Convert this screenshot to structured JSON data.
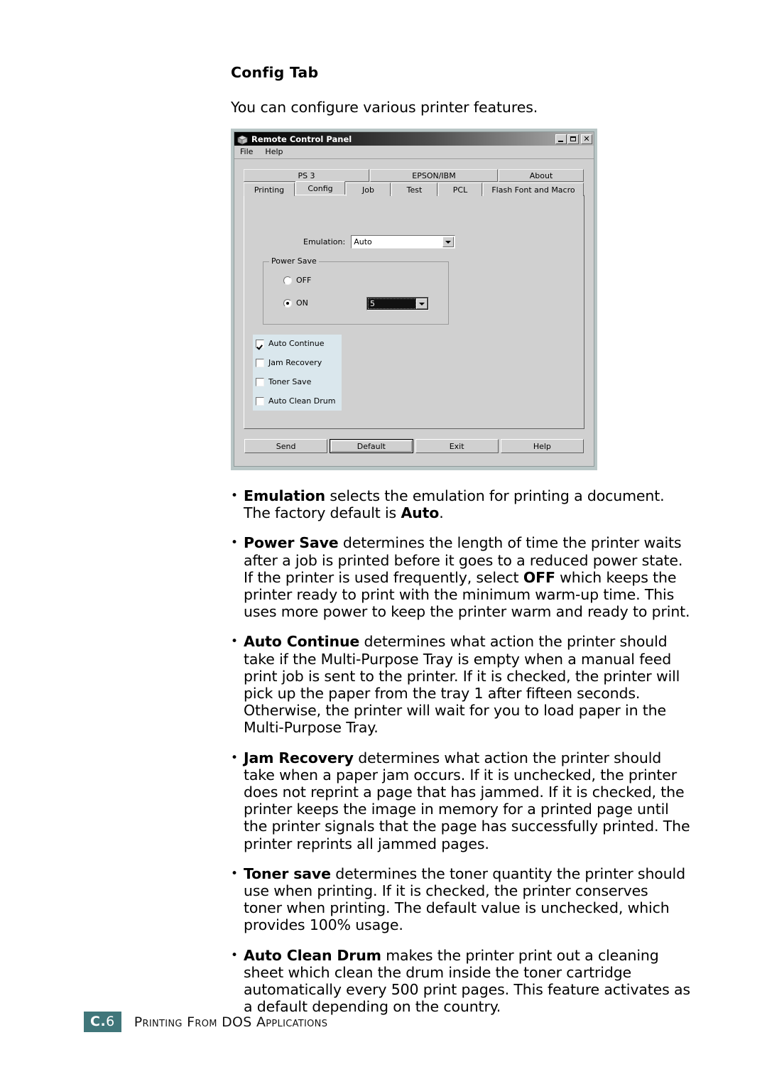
{
  "page": {
    "heading": "Config Tab",
    "intro": "You can configure various printer features.",
    "accent_color": "#40767a"
  },
  "dialog": {
    "title": "Remote Control Panel",
    "icon": "printer-box-icon",
    "window_buttons": {
      "minimize": "_",
      "maximize": "□",
      "close": "✕"
    },
    "menu": [
      {
        "label": "File"
      },
      {
        "label": "Help"
      }
    ],
    "tabs_row1": [
      {
        "label": "PS 3",
        "selected": false
      },
      {
        "label": "EPSON/IBM",
        "selected": false
      },
      {
        "label": "About",
        "selected": false
      }
    ],
    "tabs_row2": [
      {
        "label": "Printing",
        "selected": false
      },
      {
        "label": "Config",
        "selected": true
      },
      {
        "label": "Job",
        "selected": false
      },
      {
        "label": "Test",
        "selected": false
      },
      {
        "label": "PCL",
        "selected": false
      },
      {
        "label": "Flash Font and Macro",
        "selected": false
      }
    ],
    "emulation": {
      "label": "Emulation:",
      "value": "Auto"
    },
    "power_save": {
      "group_label": "Power Save",
      "options": [
        {
          "label": "OFF",
          "selected": false
        },
        {
          "label": "ON",
          "selected": true
        }
      ],
      "minutes_value": "5"
    },
    "checkboxes": [
      {
        "label": "Auto Continue",
        "checked": true
      },
      {
        "label": "Jam Recovery",
        "checked": false
      },
      {
        "label": "Toner Save",
        "checked": false
      },
      {
        "label": "Auto Clean Drum",
        "checked": false
      }
    ],
    "buttons": [
      {
        "label": "Send",
        "default": false
      },
      {
        "label": "Default",
        "default": true
      },
      {
        "label": "Exit",
        "default": false
      },
      {
        "label": "Help",
        "default": false
      }
    ]
  },
  "bullets": [
    {
      "id": "emulation",
      "lines": [
        [
          {
            "b": true,
            "t": "Emulation"
          },
          {
            "b": false,
            "t": " selects the emulation for printing a document."
          }
        ],
        [
          {
            "b": false,
            "t": "The factory default is "
          },
          {
            "b": true,
            "t": "Auto"
          },
          {
            "b": false,
            "t": "."
          }
        ]
      ]
    },
    {
      "id": "power-save",
      "lines": [
        [
          {
            "b": true,
            "t": "Power Save"
          },
          {
            "b": false,
            "t": " determines the length of time the printer waits"
          }
        ],
        [
          {
            "b": false,
            "t": "after a job is printed before it goes to a reduced power state."
          }
        ],
        [
          {
            "b": false,
            "t": "If the printer is used frequently, select "
          },
          {
            "b": true,
            "t": "OFF"
          },
          {
            "b": false,
            "t": " which keeps the"
          }
        ],
        [
          {
            "b": false,
            "t": "printer ready to print with the minimum warm-up time. This"
          }
        ],
        [
          {
            "b": false,
            "t": "uses more power to keep the printer warm and ready to print."
          }
        ]
      ]
    },
    {
      "id": "auto-continue",
      "lines": [
        [
          {
            "b": true,
            "t": "Auto Continue"
          },
          {
            "b": false,
            "t": " determines what action the printer should"
          }
        ],
        [
          {
            "b": false,
            "t": "take if the Multi-Purpose Tray is empty when a manual feed"
          }
        ],
        [
          {
            "b": false,
            "t": "print job is sent to the printer. If it is checked, the printer will"
          }
        ],
        [
          {
            "b": false,
            "t": "pick up the paper from the tray 1 after fifteen seconds."
          }
        ],
        [
          {
            "b": false,
            "t": "Otherwise, the printer will wait for you to load paper in the"
          }
        ],
        [
          {
            "b": false,
            "t": "Multi-Purpose Tray."
          }
        ]
      ]
    },
    {
      "id": "jam-recovery",
      "lines": [
        [
          {
            "b": true,
            "t": "Jam Recovery"
          },
          {
            "b": false,
            "t": " determines what action the printer should"
          }
        ],
        [
          {
            "b": false,
            "t": "take when a paper jam occurs. If it is unchecked, the printer"
          }
        ],
        [
          {
            "b": false,
            "t": "does not reprint a page that has jammed. If it is checked, the"
          }
        ],
        [
          {
            "b": false,
            "t": "printer keeps the image in memory for a printed page until"
          }
        ],
        [
          {
            "b": false,
            "t": "the printer signals that the page has successfully printed. The"
          }
        ],
        [
          {
            "b": false,
            "t": "printer reprints all jammed pages."
          }
        ]
      ]
    },
    {
      "id": "toner-save",
      "lines": [
        [
          {
            "b": true,
            "t": "Toner save"
          },
          {
            "b": false,
            "t": " determines the toner quantity the printer should"
          }
        ],
        [
          {
            "b": false,
            "t": "use when printing. If it is checked, the printer conserves"
          }
        ],
        [
          {
            "b": false,
            "t": "toner when printing. The default value is unchecked, which"
          }
        ],
        [
          {
            "b": false,
            "t": "provides 100% usage."
          }
        ]
      ]
    },
    {
      "id": "auto-clean-drum",
      "lines": [
        [
          {
            "b": true,
            "t": "Auto Clean Drum"
          },
          {
            "b": false,
            "t": " makes the printer print out a cleaning"
          }
        ],
        [
          {
            "b": false,
            "t": "sheet which clean the drum inside the toner cartridge"
          }
        ],
        [
          {
            "b": false,
            "t": "automatically every 500 print pages. This feature activates as"
          }
        ],
        [
          {
            "b": false,
            "t": "a default depending on the country."
          }
        ]
      ]
    }
  ],
  "footer": {
    "chapter": "C.",
    "page_number": "6",
    "title": "Printing From DOS Applications"
  }
}
